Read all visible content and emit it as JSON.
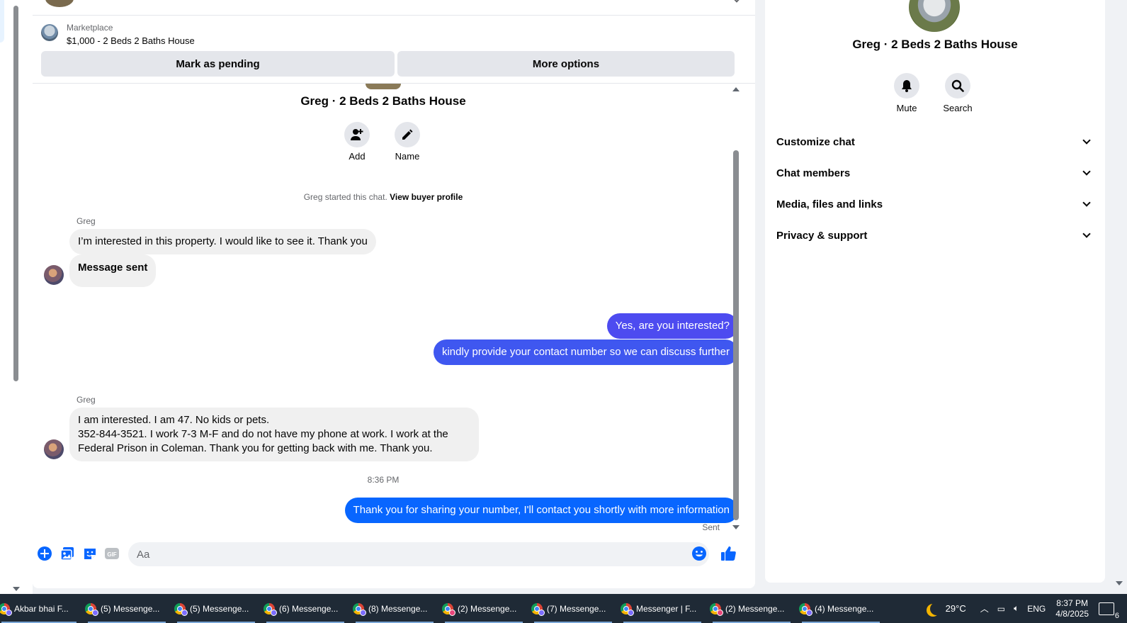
{
  "listing": {
    "category": "Marketplace",
    "title": "$1,000 - 2 Beds 2 Baths House",
    "mark_pending_label": "Mark as pending",
    "more_options_label": "More options"
  },
  "conversation": {
    "title": "Greg · 2 Beds 2 Baths House",
    "actions": {
      "add": "Add",
      "name": "Name"
    },
    "started_text": "Greg started this chat.",
    "view_profile_label": "View buyer profile",
    "sender_name": "Greg",
    "messages": {
      "m1": "I’m interested in this property. I would like to see it. Thank you",
      "m2": "Message sent",
      "m3": "Yes, are you interested?",
      "m4": "kindly provide your contact number so we can discuss further",
      "m5": "I am interested. I am 47. No kids or pets.\n352-844-3521. I work 7-3 M-F and do not have my phone at work.   I work at the Federal Prison in Coleman. Thank you for getting back with me. Thank you.",
      "m6": "Thank you for sharing your number, I'll contact you shortly with more information"
    },
    "timestamp": "8:36 PM",
    "sent_status": "Sent"
  },
  "composer": {
    "placeholder": "Aa",
    "icons": [
      "plus-icon",
      "photo-icon",
      "sticker-icon",
      "gif-icon",
      "emoji-icon",
      "thumbs-up-icon"
    ],
    "gif_text": "GIF"
  },
  "details": {
    "title": "Greg · 2 Beds 2 Baths House",
    "mute_label": "Mute",
    "search_label": "Search",
    "sections": [
      "Customize chat",
      "Chat members",
      "Media, files and links",
      "Privacy & support"
    ]
  },
  "taskbar": {
    "tasks": [
      "Akbar bhai F...",
      "(5) Messenge...",
      "(5) Messenge...",
      "(6) Messenge...",
      "(8) Messenge...",
      "(2) Messenge...",
      "(7) Messenge...",
      "Messenger | F...",
      "(2) Messenge...",
      "(4) Messenge..."
    ],
    "weather": "29°C",
    "language": "ENG",
    "time": "8:37 PM",
    "date": "4/8/2025",
    "notification_count": "6"
  },
  "colors": {
    "outgoing_1": "#4d4bf0",
    "outgoing_2": "#3f57f0",
    "outgoing_latest": "#0866ff",
    "accent": "#0866ff",
    "incoming_bubble": "#f0f0f0"
  }
}
